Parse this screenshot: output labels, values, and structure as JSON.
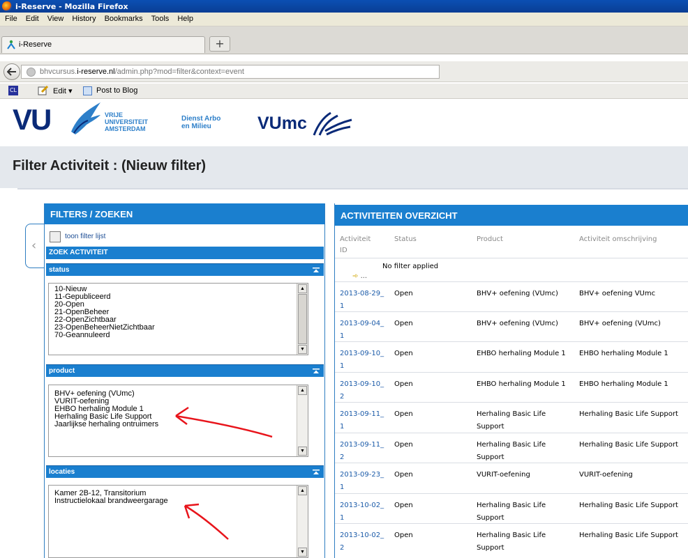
{
  "window": {
    "title": "i-Reserve - Mozilla Firefox"
  },
  "menu": [
    "File",
    "Edit",
    "View",
    "History",
    "Bookmarks",
    "Tools",
    "Help"
  ],
  "tab": {
    "label": "i-Reserve",
    "newtab": "+"
  },
  "nav": {
    "url_prefix": "bhvcursus.",
    "url_domain": "i-reserve.nl",
    "url_path": "/admin.php?mod=filter&context=event"
  },
  "bookmarks": {
    "ct": "CL",
    "edit": "Edit",
    "post": "Post to Blog"
  },
  "logos": {
    "vu": "VU",
    "uni_line1": "VRIJE",
    "uni_line2": "UNIVERSITEIT",
    "uni_line3": "AMSTERDAM",
    "dienst_line1": "Dienst Arbo",
    "dienst_line2": "en Milieu",
    "vumc": "VUmc"
  },
  "page": {
    "title": "Filter Activiteit : (Nieuw filter)"
  },
  "filters": {
    "header": "FILTERS / ZOEKEN",
    "toon_label": "toon filter lijst",
    "zoek_header": "ZOEK ACTIVITEIT",
    "status": {
      "label": "status",
      "items": [
        "10-Nieuw",
        "11-Gepubliceerd",
        "20-Open",
        "21-OpenBeheer",
        "22-OpenZichtbaar",
        "23-OpenBeheerNietZichtbaar",
        "70-Geannuleerd"
      ]
    },
    "product": {
      "label": "product",
      "items": [
        "BHV+ oefening (VUmc)",
        "VURIT-oefening",
        "EHBO herhaling Module 1",
        "Herhaling Basic Life Support",
        "Jaarlijkse herhaling ontruimers"
      ]
    },
    "locaties": {
      "label": "locaties",
      "items": [
        "Kamer 2B-12, Transitorium",
        "Instructielokaal brandweergarage"
      ]
    }
  },
  "overview": {
    "header": "ACTIVITEITEN OVERZICHT",
    "columns": {
      "id_line1": "Activiteit",
      "id_line2": "ID",
      "status": "Status",
      "product": "Product",
      "omschrijving": "Activiteit omschrijving"
    },
    "no_filter": "No filter applied",
    "filter_glyph": "...",
    "rows": [
      {
        "id1": "2013-08-29_",
        "id2": "1",
        "status": "Open",
        "product": "BHV+ oefening (VUmc)",
        "omschrijving": "BHV+ oefening VUmc"
      },
      {
        "id1": "2013-09-04_",
        "id2": "1",
        "status": "Open",
        "product": "BHV+ oefening (VUmc)",
        "omschrijving": "BHV+ oefening (VUmc)"
      },
      {
        "id1": "2013-09-10_",
        "id2": "1",
        "status": "Open",
        "product": "EHBO herhaling Module 1",
        "omschrijving": "EHBO herhaling Module 1"
      },
      {
        "id1": "2013-09-10_",
        "id2": "2",
        "status": "Open",
        "product": "EHBO herhaling Module 1",
        "omschrijving": "EHBO herhaling Module 1"
      },
      {
        "id1": "2013-09-11_",
        "id2": "1",
        "status": "Open",
        "product": "Herhaling Basic Life Support",
        "omschrijving": "Herhaling Basic Life Support"
      },
      {
        "id1": "2013-09-11_",
        "id2": "2",
        "status": "Open",
        "product": "Herhaling Basic Life Support",
        "omschrijving": "Herhaling Basic Life Support"
      },
      {
        "id1": "2013-09-23_",
        "id2": "1",
        "status": "Open",
        "product": "VURIT-oefening",
        "omschrijving": "VURIT-oefening"
      },
      {
        "id1": "2013-10-02_",
        "id2": "1",
        "status": "Open",
        "product": "Herhaling Basic Life Support",
        "omschrijving": "Herhaling Basic Life Support"
      },
      {
        "id1": "2013-10-02_",
        "id2": "2",
        "status": "Open",
        "product": "Herhaling Basic Life Support",
        "omschrijving": "Herhaling Basic Life Support"
      }
    ]
  },
  "colors": {
    "panel_blue": "#1a7fcf",
    "annotation_red": "#e8141b",
    "link_blue": "#1a5aa8"
  }
}
